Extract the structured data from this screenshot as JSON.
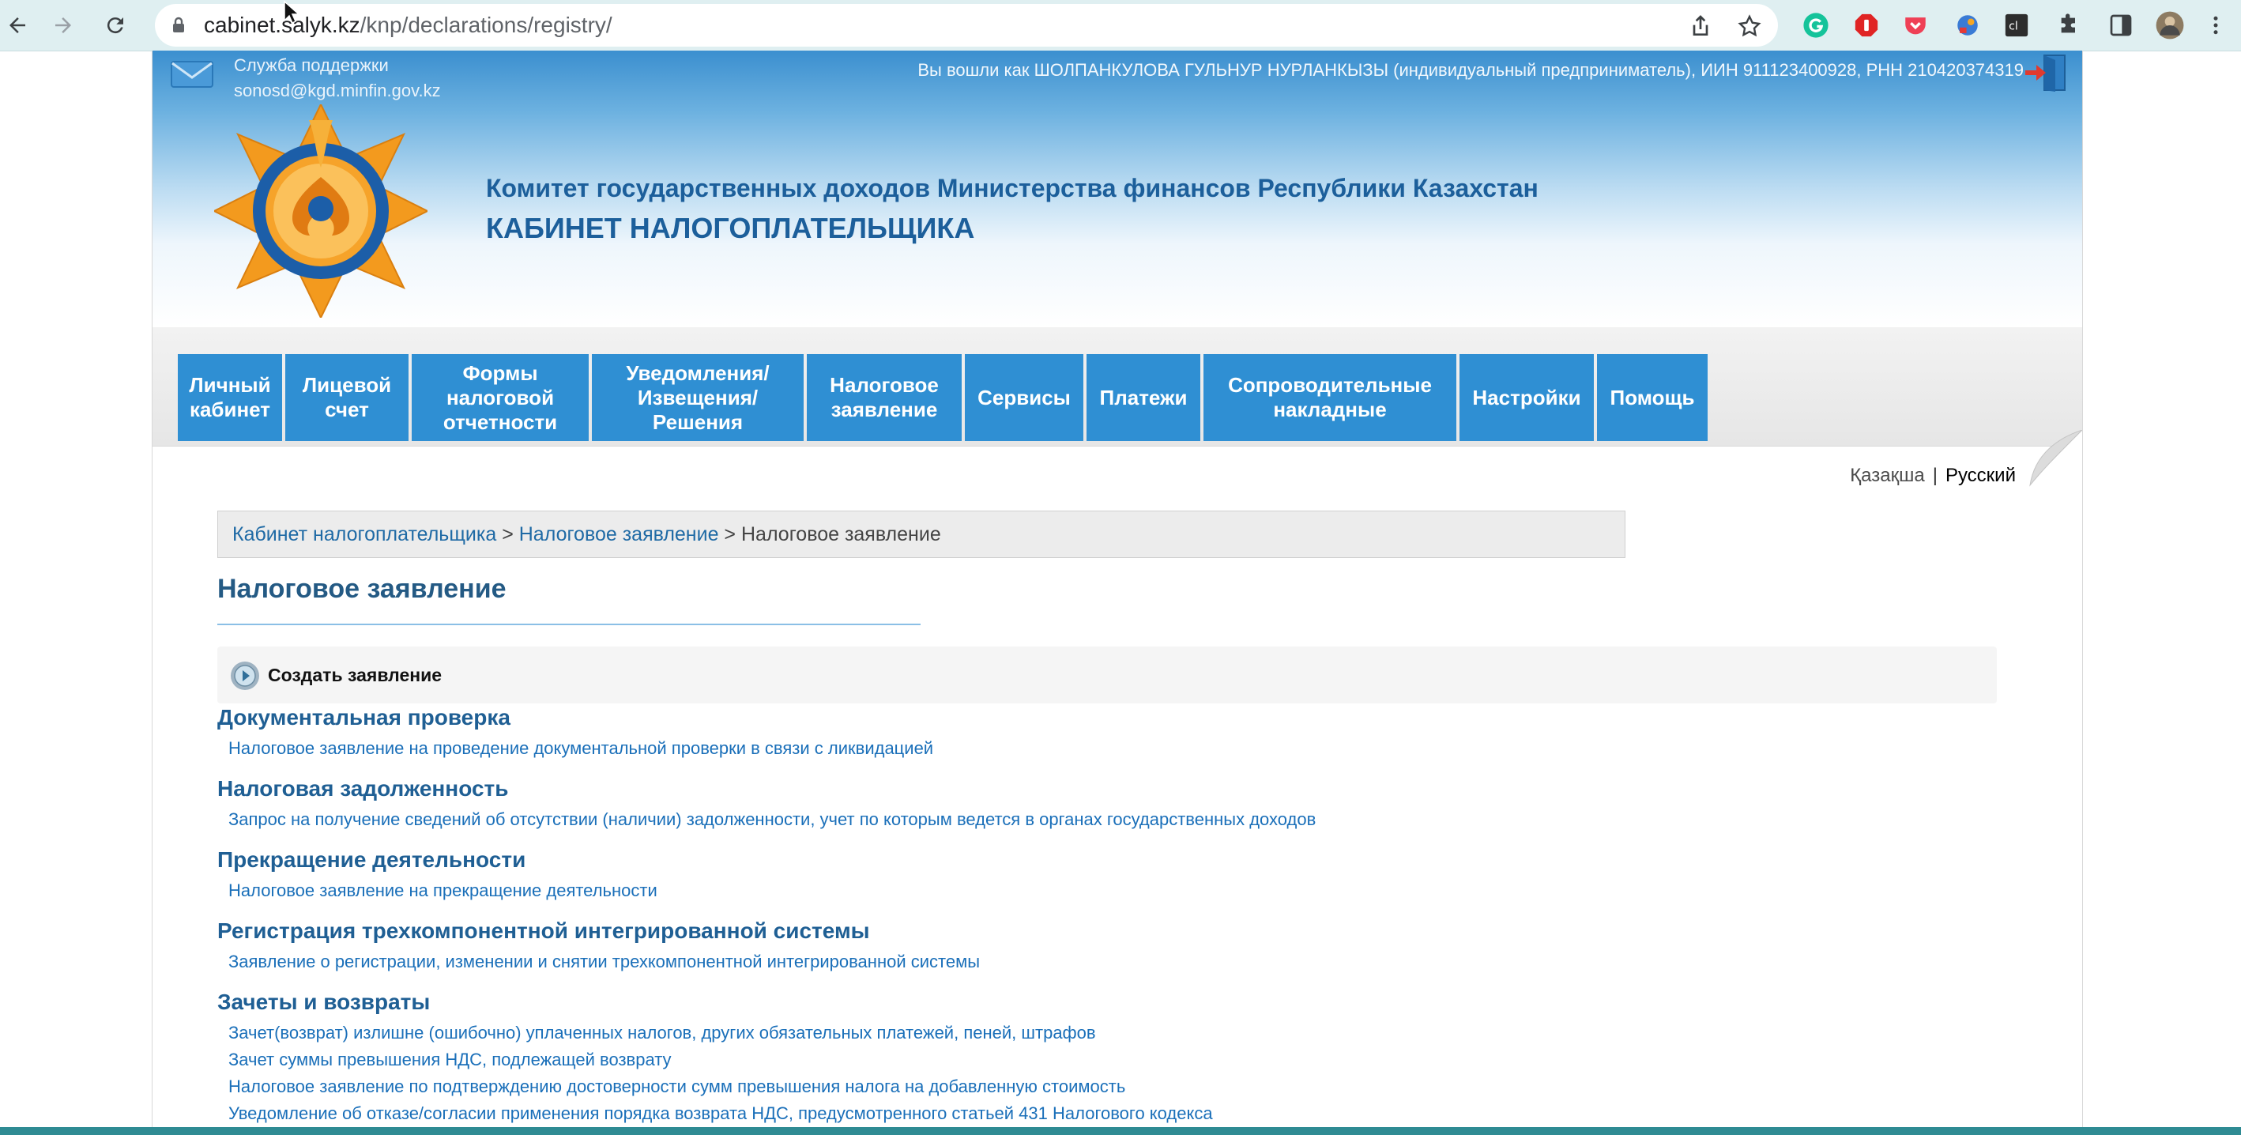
{
  "browser": {
    "url_domain": "cabinet.salyk.kz",
    "url_path": "/knp/declarations/registry/"
  },
  "header": {
    "support_label": "Служба поддержки",
    "support_email": "sonosd@kgd.minfin.gov.kz",
    "user_line": "Вы вошли как ШОЛПАНКУЛОВА ГУЛЬНУР НУРЛАНКЫЗЫ (индивидуальный предприниматель), ИИН 911123400928, РНН 210420374319",
    "org_title": "Комитет государственных доходов Министерства финансов Республики Казахстан",
    "cabinet_title": "КАБИНЕТ НАЛОГОПЛАТЕЛЬЩИКА"
  },
  "menu": [
    {
      "label_lines": [
        "Личный",
        "кабинет"
      ]
    },
    {
      "label_lines": [
        "Лицевой",
        "счет"
      ]
    },
    {
      "label_lines": [
        "Формы",
        "налоговой",
        "отчетности"
      ]
    },
    {
      "label_lines": [
        "Уведомления/",
        "Извещения/",
        "Решения"
      ]
    },
    {
      "label_lines": [
        "Налоговое",
        "заявление"
      ]
    },
    {
      "label_lines": [
        "Сервисы"
      ]
    },
    {
      "label_lines": [
        "Платежи"
      ]
    },
    {
      "label_lines": [
        "Сопроводительные",
        "накладные"
      ]
    },
    {
      "label_lines": [
        "Настройки"
      ]
    },
    {
      "label_lines": [
        "Помощь"
      ]
    }
  ],
  "language": {
    "kazakh": "Қазақша",
    "separator": "|",
    "russian": "Русский"
  },
  "breadcrumb": {
    "item1": "Кабинет налогоплательщика",
    "sep1": " > ",
    "item2": "Налоговое заявление",
    "sep2": " > ",
    "current": "Налоговое заявление"
  },
  "page_title": "Налоговое заявление",
  "create_label": "Создать заявление",
  "sections": [
    {
      "title": "Документальная проверка",
      "links": [
        "Налоговое заявление на проведение документальной проверки в связи с ликвидацией"
      ]
    },
    {
      "title": "Налоговая задолженность",
      "links": [
        "Запрос на получение сведений об отсутствии (наличии) задолженности, учет по которым ведется в органах государственных доходов"
      ]
    },
    {
      "title": "Прекращение деятельности",
      "links": [
        "Налоговое заявление на прекращение деятельности"
      ]
    },
    {
      "title": "Регистрация трехкомпонентной интегрированной системы",
      "links": [
        "Заявление о регистрации, изменении и снятии трехкомпонентной интегрированной системы"
      ]
    },
    {
      "title": "Зачеты и возвраты",
      "links": [
        "Зачет(возврат) излишне (ошибочно) уплаченных налогов, других обязательных платежей, пеней, штрафов",
        "Зачет суммы превышения НДС, подлежащей возврату",
        "Налоговое заявление по подтверждению достоверности сумм превышения налога на добавленную стоимость",
        "Уведомление об отказе/согласии применения порядка возврата НДС, предусмотренного статьей 431 Налогового кодекса"
      ]
    }
  ]
}
